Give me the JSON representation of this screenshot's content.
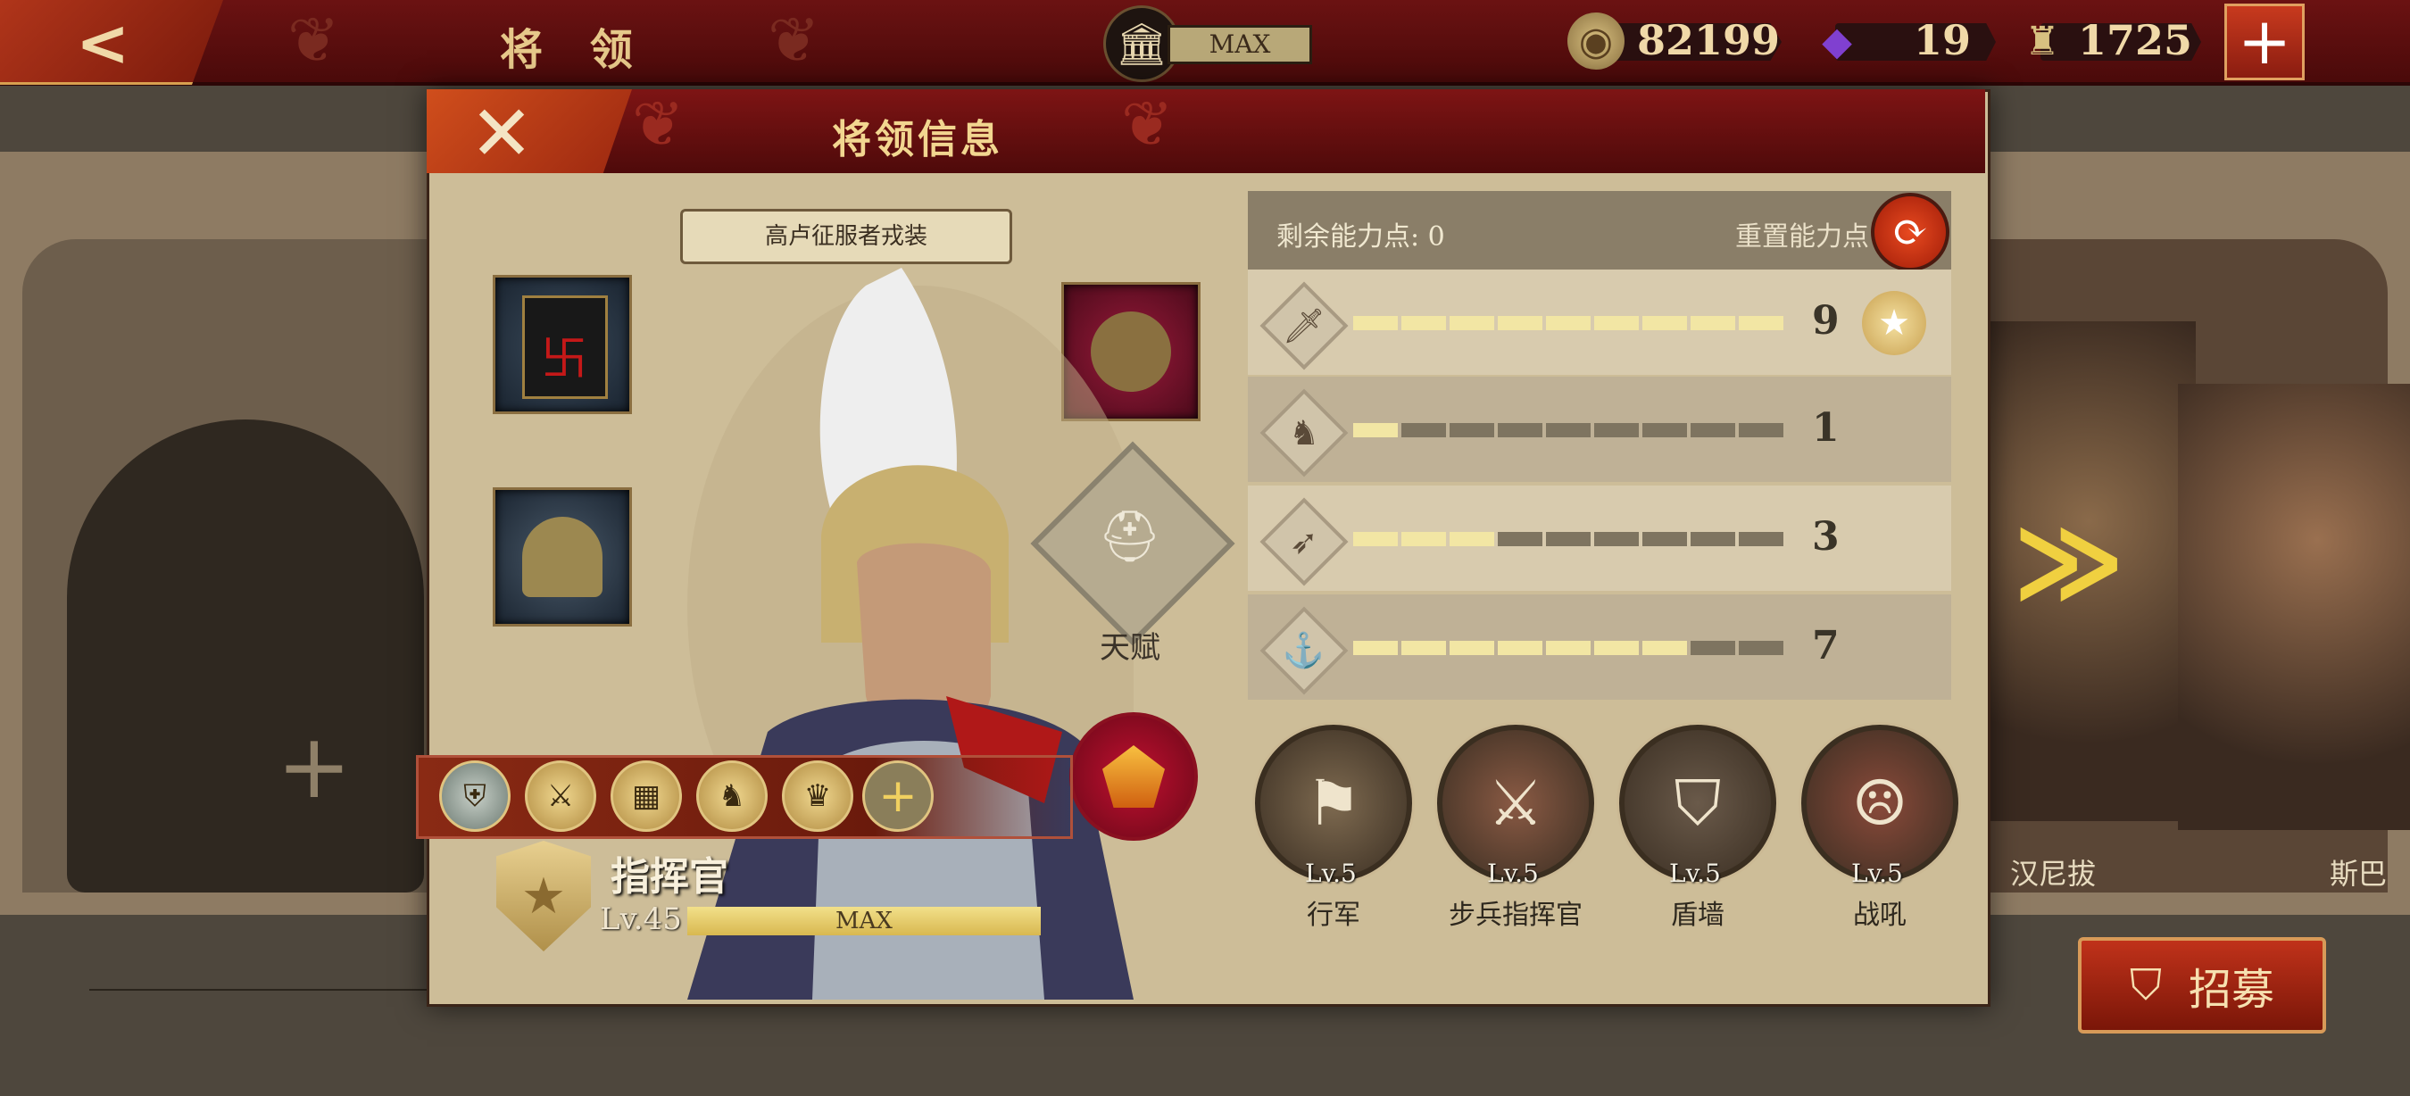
{
  "topbar": {
    "title": "将 领",
    "building_status": "MAX",
    "resources": [
      {
        "name": "coin",
        "icon": "coin-icon",
        "value": "82199"
      },
      {
        "name": "gem",
        "icon": "purple-gem-icon",
        "value": "19"
      },
      {
        "name": "honor",
        "icon": "spqr-eagle-icon",
        "value": "1725"
      }
    ],
    "back_icon": "back-arrow-icon",
    "plus_icon": "plus-icon"
  },
  "modal": {
    "title": "将领信息",
    "outfit_button": "高卢征服者戎装",
    "talent_label": "天赋",
    "rank_name": "指挥官",
    "level": "Lv.45",
    "xp_status": "MAX",
    "badges": [
      "shield-badge-icon",
      "sword-badge-icon",
      "formation-badge-icon",
      "horse-badge-icon",
      "eagle-badge-icon",
      "add-badge-icon"
    ]
  },
  "stats": {
    "points_label": "剩余能力点: 0",
    "reset_label": "重置能力点",
    "max_level": 9,
    "rows": [
      {
        "icon": "sword-icon",
        "value": 9
      },
      {
        "icon": "horse-icon",
        "value": 1
      },
      {
        "icon": "bow-icon",
        "value": 3
      },
      {
        "icon": "anchor-icon",
        "value": 7
      }
    ]
  },
  "skills": [
    {
      "name": "行军",
      "level": "Lv.5",
      "icon": "march-icon"
    },
    {
      "name": "步兵指挥官",
      "level": "Lv.5",
      "icon": "crossed-swords-icon"
    },
    {
      "name": "盾墙",
      "level": "Lv.5",
      "icon": "shield-wall-icon"
    },
    {
      "name": "战吼",
      "level": "Lv.5",
      "icon": "war-cry-icon"
    }
  ],
  "background": {
    "right_card_name_1": "汉尼拔",
    "right_card_name_2": "斯巴",
    "recruit_label": "招募"
  },
  "colors": {
    "accent_red": "#7e1414",
    "gold": "#f2d690",
    "bar_fill": "#f2e6a4",
    "bar_empty": "#7e7460"
  }
}
